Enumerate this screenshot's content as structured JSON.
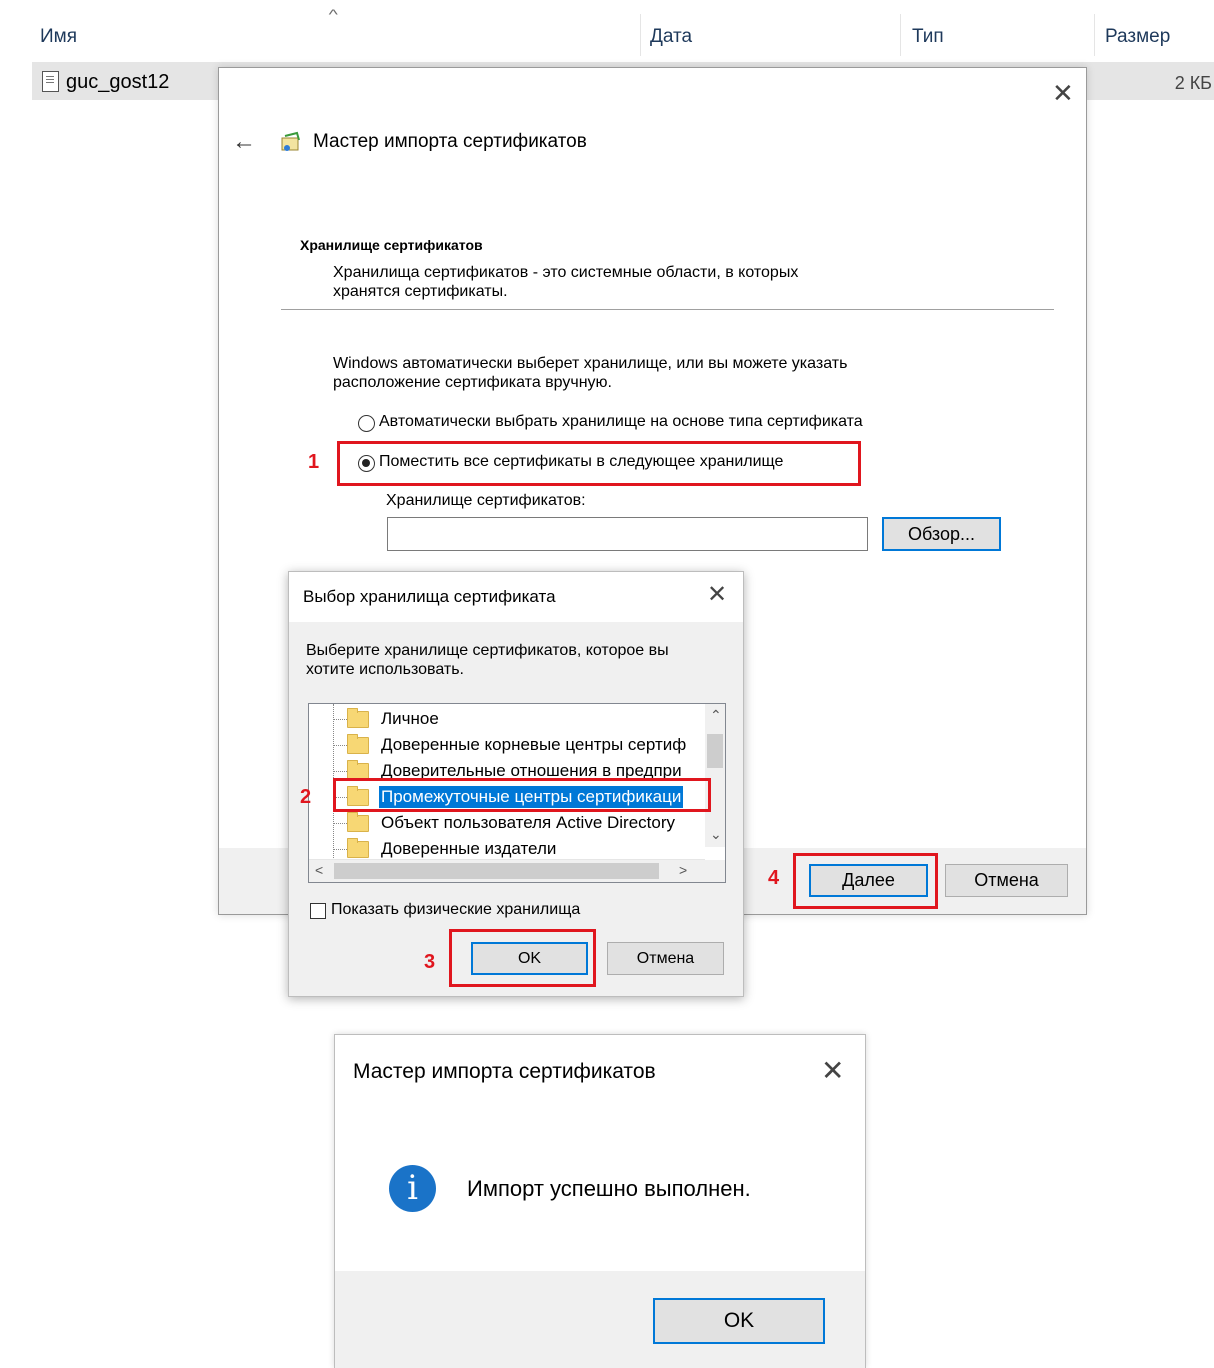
{
  "explorer": {
    "columns": {
      "name": "Имя",
      "date": "Дата",
      "type": "Тип",
      "size": "Размер"
    },
    "sort_indicator": "^",
    "file": {
      "name": "guc_gost12",
      "size": "2 КБ",
      "icon": "certificate-file-icon"
    }
  },
  "wizard": {
    "title": "Мастер импорта сертификатов",
    "back_icon": "back-arrow-icon",
    "close_icon": "close-icon",
    "section_title": "Хранилище сертификатов",
    "section_desc_line1": "Хранилища сертификатов - это системные области, в которых",
    "section_desc_line2": "хранятся сертификаты.",
    "intro_line1": "Windows автоматически выберет хранилище, или вы можете указать",
    "intro_line2": "расположение сертификата вручную.",
    "radio_auto": "Автоматически выбрать хранилище на основе типа сертификата",
    "radio_manual": "Поместить все сертификаты в следующее хранилище",
    "store_label": "Хранилище сертификатов:",
    "store_value": "",
    "browse_button": "Обзор...",
    "next_button": "Далее",
    "cancel_button": "Отмена"
  },
  "store_dialog": {
    "title": "Выбор хранилища сертификата",
    "desc_line1": "Выберите хранилище сертификатов, которое вы",
    "desc_line2": "хотите использовать.",
    "items": [
      {
        "label": "Личное"
      },
      {
        "label": "Доверенные корневые центры сертиф"
      },
      {
        "label": "Доверительные отношения в предпри"
      },
      {
        "label": "Промежуточные центры сертификаци",
        "selected": true
      },
      {
        "label": "Объект пользователя Active Directory"
      },
      {
        "label": "Доверенные издатели"
      }
    ],
    "show_physical": "Показать физические хранилища",
    "ok_button": "OK",
    "cancel_button": "Отмена"
  },
  "annotations": {
    "step1": "1",
    "step2": "2",
    "step3": "3",
    "step4": "4",
    "color": "#e0161e"
  },
  "success_dialog": {
    "title": "Мастер импорта сертификатов",
    "message": "Импорт успешно выполнен.",
    "icon": "info-icon",
    "icon_glyph": "i",
    "ok_button": "OK"
  }
}
